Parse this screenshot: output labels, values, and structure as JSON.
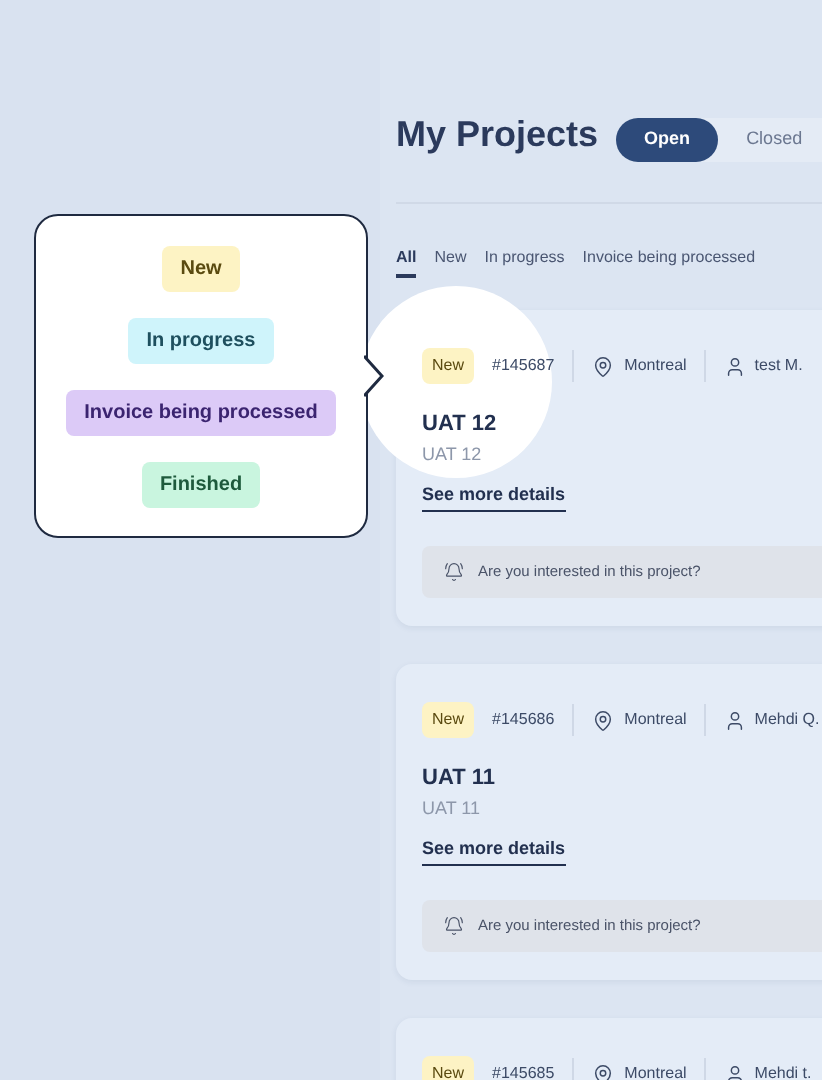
{
  "header": {
    "title": "My Projects",
    "toggle": [
      {
        "label": "Open",
        "selected": true
      },
      {
        "label": "Closed",
        "selected": false
      }
    ]
  },
  "tabs": [
    {
      "label": "All",
      "selected": true
    },
    {
      "label": "New",
      "selected": false
    },
    {
      "label": "In progress",
      "selected": false
    },
    {
      "label": "Invoice being processed",
      "selected": false
    }
  ],
  "legend": {
    "statuses": [
      {
        "label": "New",
        "color": "#fdf3c4"
      },
      {
        "label": "In progress",
        "color": "#cff4fb"
      },
      {
        "label": "Invoice being processed",
        "color": "#dccaf7"
      },
      {
        "label": "Finished",
        "color": "#c9f5df"
      }
    ]
  },
  "projects": [
    {
      "status": "New",
      "number": "#145687",
      "location": "Montreal",
      "person": "test M.",
      "title": "UAT 12",
      "subtitle": "UAT 12",
      "link": "See more details",
      "interest": "Are you interested in this project?",
      "highlighted": true
    },
    {
      "status": "New",
      "number": "#145686",
      "location": "Montreal",
      "person": "Mehdi Q.",
      "title": "UAT 11",
      "subtitle": "UAT 11",
      "link": "See more details",
      "interest": "Are you interested in this project?",
      "highlighted": false
    },
    {
      "status": "New",
      "number": "#145685",
      "location": "Montreal",
      "person": "Mehdi t.",
      "highlighted": false
    }
  ]
}
